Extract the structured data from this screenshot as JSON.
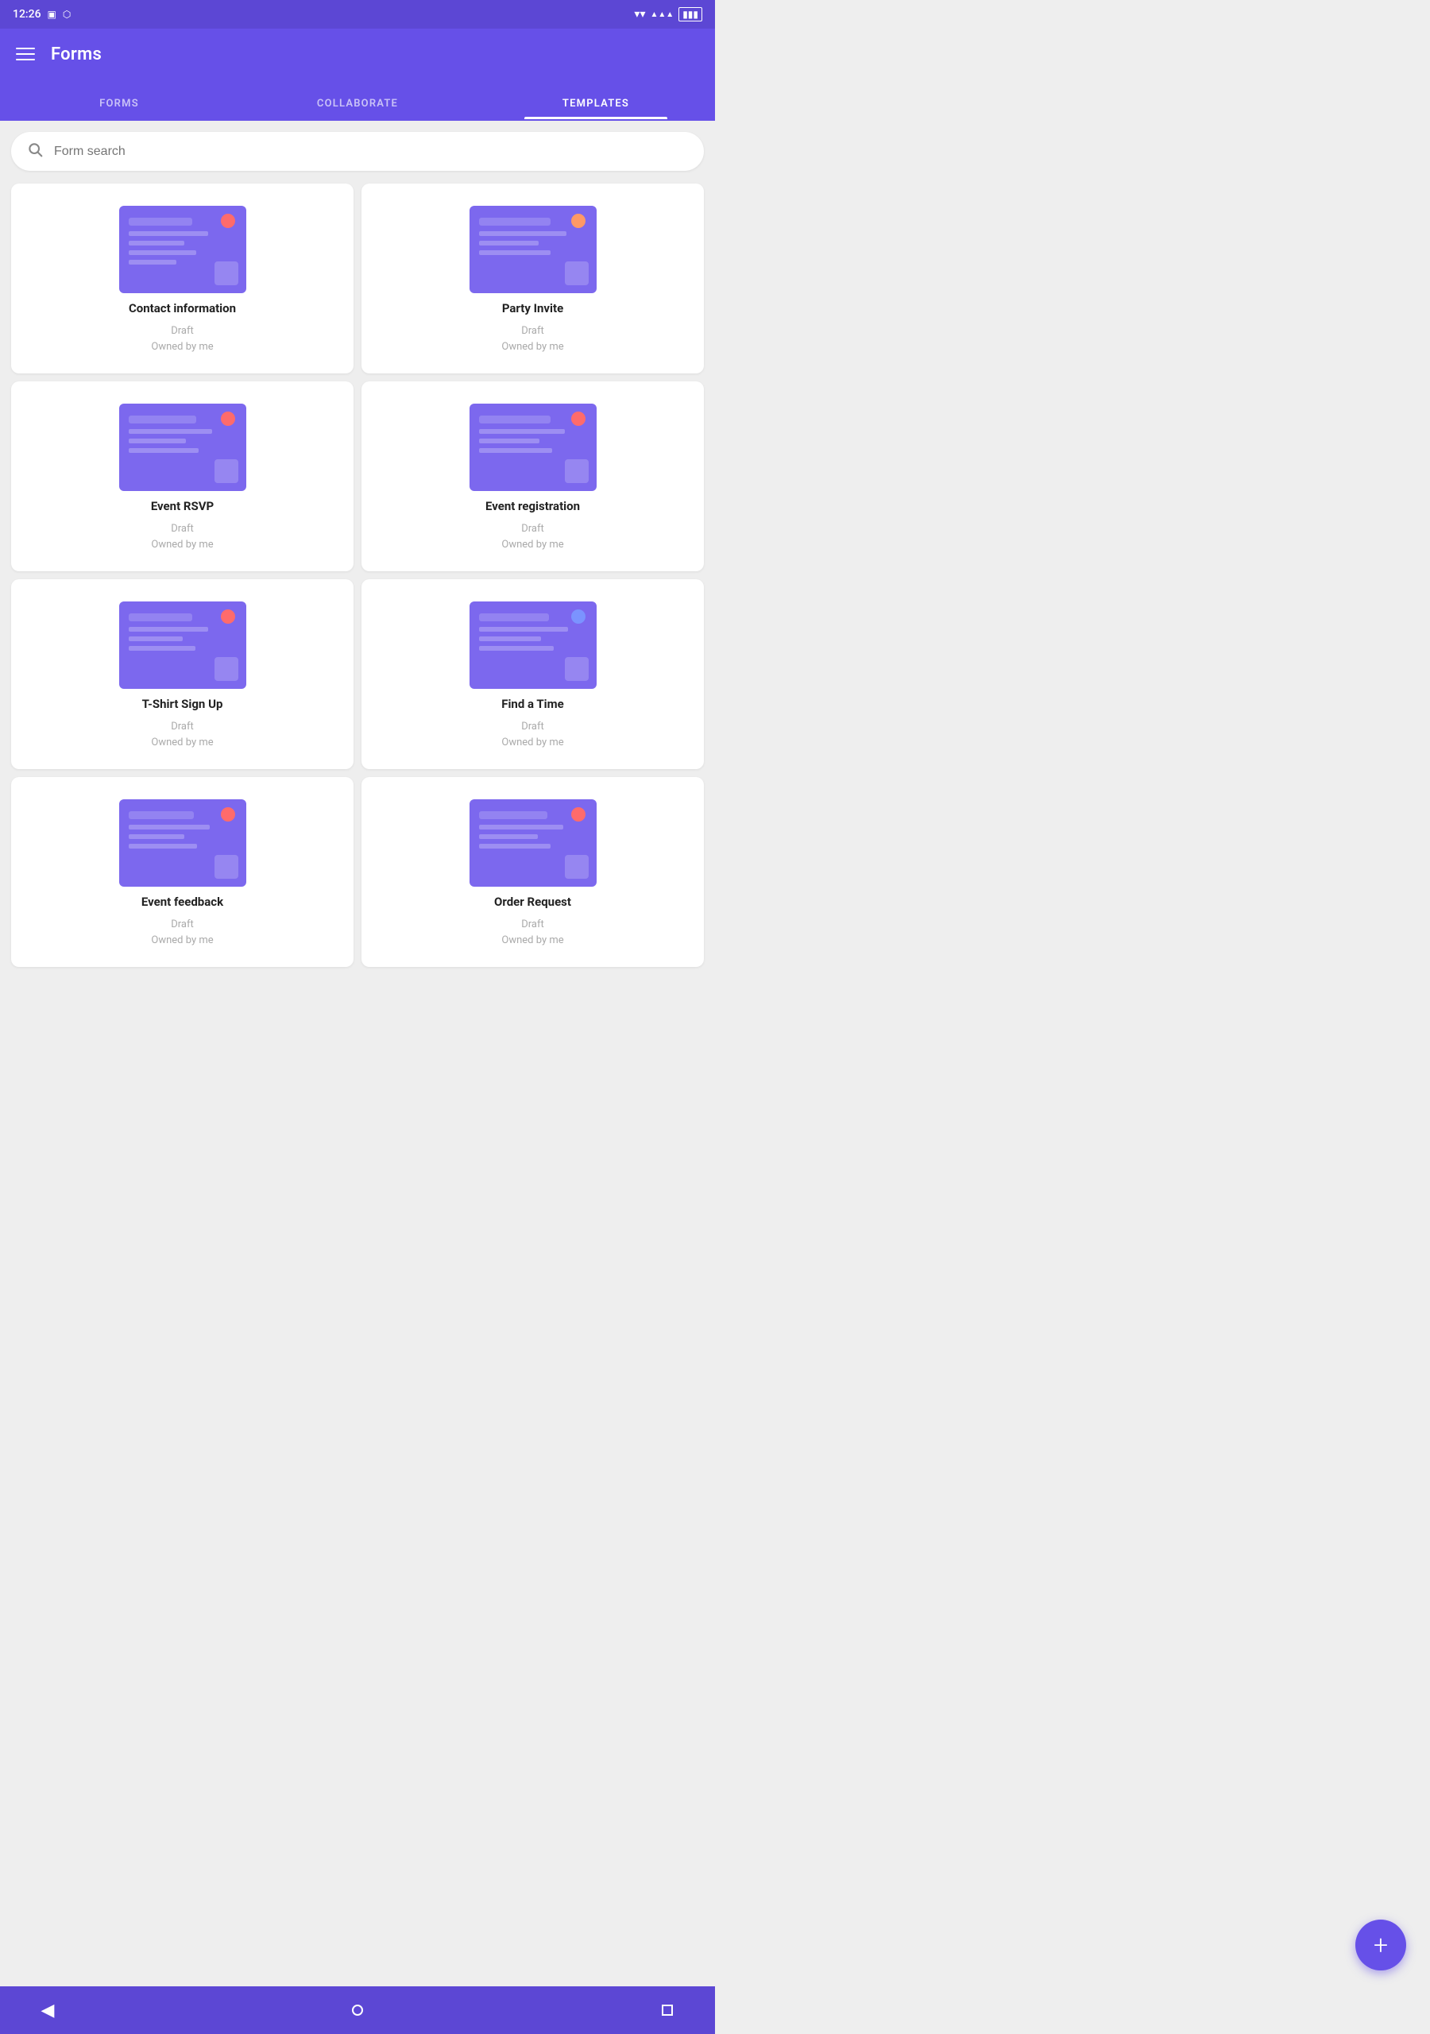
{
  "statusBar": {
    "time": "12:26",
    "icons": [
      "sim",
      "storage",
      "wifi",
      "signal",
      "battery"
    ]
  },
  "appBar": {
    "title": "Forms"
  },
  "tabs": [
    {
      "id": "forms",
      "label": "FORMS",
      "active": false
    },
    {
      "id": "collaborate",
      "label": "COLLABORATE",
      "active": false
    },
    {
      "id": "templates",
      "label": "TEMPLATES",
      "active": true
    }
  ],
  "search": {
    "placeholder": "Form search"
  },
  "cards": [
    {
      "id": "contact-information",
      "title": "Contact information",
      "status": "Draft",
      "owner": "Owned by me"
    },
    {
      "id": "party-invite",
      "title": "Party Invite",
      "status": "Draft",
      "owner": "Owned by me"
    },
    {
      "id": "event-rsvp",
      "title": "Event RSVP",
      "status": "Draft",
      "owner": "Owned by me"
    },
    {
      "id": "event-registration",
      "title": "Event registration",
      "status": "Draft",
      "owner": "Owned by me"
    },
    {
      "id": "tshirt-signup",
      "title": "T-Shirt Sign Up",
      "status": "Draft",
      "owner": "Owned by me"
    },
    {
      "id": "find-a-time",
      "title": "Find a Time",
      "status": "Draft",
      "owner": "Owned by me"
    },
    {
      "id": "event-feedback",
      "title": "Event feedback",
      "status": "Draft",
      "owner": "Owned by me"
    },
    {
      "id": "order-request",
      "title": "Order Request",
      "status": "Draft",
      "owner": "Owned by me"
    }
  ],
  "fab": {
    "label": "+"
  },
  "bottomNav": {
    "back": "◀",
    "home": "circle",
    "recent": "square"
  },
  "colors": {
    "primary": "#6650e8",
    "primaryDark": "#5c47d4",
    "accent": "#ff6b6b"
  }
}
